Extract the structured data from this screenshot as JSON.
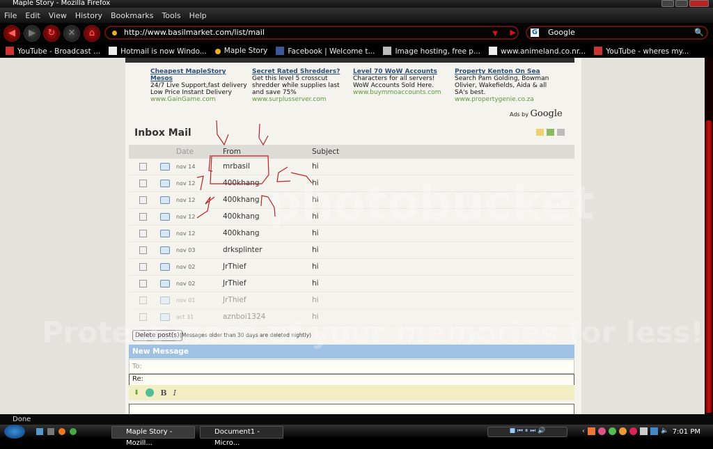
{
  "window": {
    "title": "Maple Story - Mozilla Firefox"
  },
  "menu": [
    "File",
    "Edit",
    "View",
    "History",
    "Bookmarks",
    "Tools",
    "Help"
  ],
  "nav": {
    "url": "http://www.basilmarket.com/list/mail",
    "search_engine": "Google"
  },
  "bookmarks": [
    "YouTube - Broadcast ...",
    "Hotmail is now Windo...",
    "Maple Story",
    "Facebook | Welcome t...",
    "Image hosting, free p...",
    "www.animeland.co.nr...",
    "YouTube - wheres my..."
  ],
  "ads": [
    {
      "title": "Cheapest MapleStory Mesos",
      "text": "24/7 Live Support,fast delivery Low Price Instant Delivery",
      "url": "www.GainGame.com"
    },
    {
      "title": "Secret Rated Shredders?",
      "text": "Get this level 5 crosscut shredder while supplies last and save 75%",
      "url": "www.surplusserver.com"
    },
    {
      "title": "Level 70 WoW Accounts",
      "text": "Characters for all servers! WoW Accounts Sold Here.",
      "url": "www.buymmoaccounts.com"
    },
    {
      "title": "Property Kenton On Sea",
      "text": "Search Pam Golding, Bowman Olivier, Wakefields, Aida & all SA's best.",
      "url": "www.propertygenie.co.za"
    }
  ],
  "ads_by": "Ads by",
  "ads_brand": "Google",
  "inbox": {
    "title": "Inbox Mail",
    "columns": {
      "date": "Date",
      "from": "From",
      "subject": "Subject"
    },
    "rows": [
      {
        "date": "nov 14",
        "from": "mrbasil",
        "subject": "hi"
      },
      {
        "date": "nov 12",
        "from": "400khang",
        "subject": "hi"
      },
      {
        "date": "nov 12",
        "from": "400khang",
        "subject": "hi"
      },
      {
        "date": "nov 12",
        "from": "400khang",
        "subject": "hi"
      },
      {
        "date": "nov 12",
        "from": "400khang",
        "subject": "hi"
      },
      {
        "date": "nov 03",
        "from": "drksplinter",
        "subject": "hi"
      },
      {
        "date": "nov 02",
        "from": "JrThief",
        "subject": "hi"
      },
      {
        "date": "nov 02",
        "from": "JrThief",
        "subject": "hi"
      },
      {
        "date": "nov 01",
        "from": "JrThief",
        "subject": "hi"
      },
      {
        "date": "oct 31",
        "from": "aznboi1324",
        "subject": "hi"
      }
    ],
    "delete_label": "Delete post(s)",
    "delete_note": "(Messages older than 30 days are deleted nightly)"
  },
  "compose": {
    "header": "New Message",
    "to_label": "To:",
    "re_label": "Re:",
    "bold": "B",
    "italic": "I"
  },
  "watermark": {
    "brand": "photobucket",
    "slogan": "Protect more of your memories for less!"
  },
  "status": "Done",
  "taskbar": {
    "tasks": [
      "Maple Story - Mozill...",
      "Document1 - Micro..."
    ],
    "clock": "7:01 PM"
  },
  "colors": {
    "accent_red": "#cc1111",
    "compose_header": "#9fc1e3"
  }
}
